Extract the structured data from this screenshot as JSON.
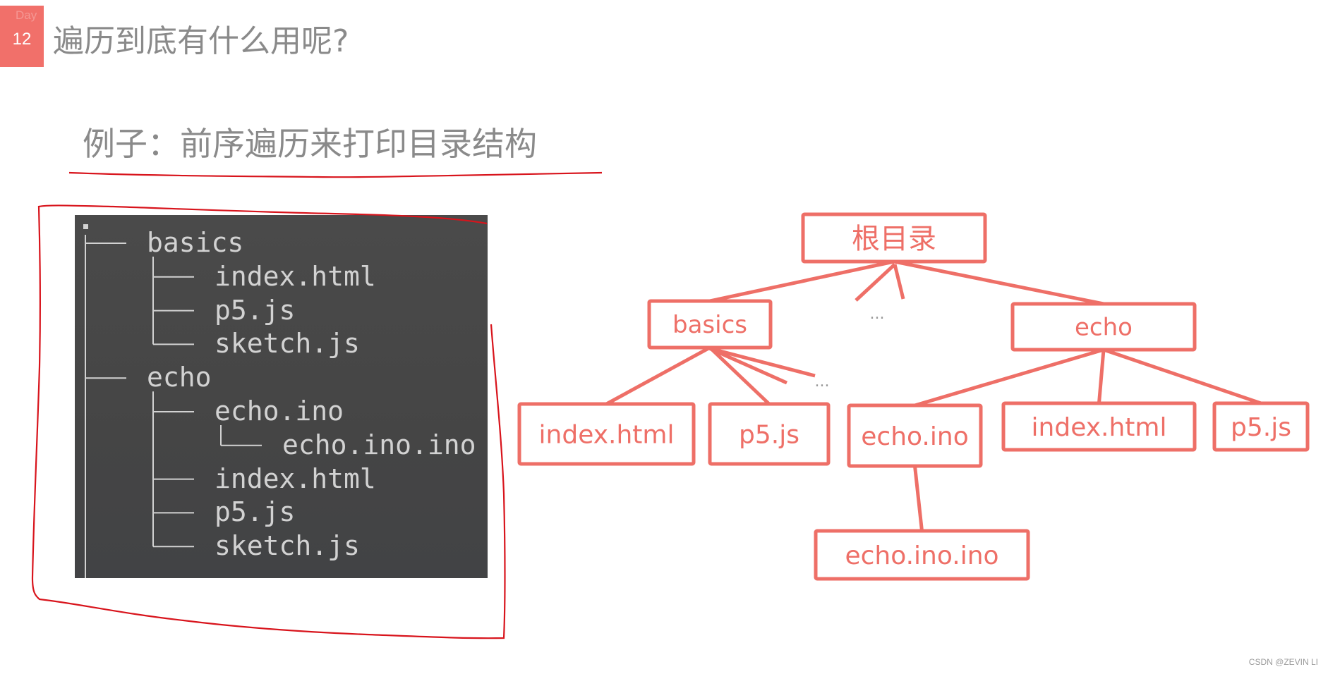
{
  "header": {
    "badge_top": "Day",
    "badge_number": "12",
    "title": "遍历到底有什么用呢?"
  },
  "subtitle": "例子：前序遍历来打印目录结构",
  "terminal": {
    "root": ".",
    "lines": [
      {
        "prefix": "├── ",
        "name": "basics",
        "depth": 0
      },
      {
        "prefix": "├── ",
        "name": "index.html",
        "depth": 1
      },
      {
        "prefix": "├── ",
        "name": "p5.js",
        "depth": 1
      },
      {
        "prefix": "└── ",
        "name": "sketch.js",
        "depth": 1
      },
      {
        "prefix": "├── ",
        "name": "echo",
        "depth": 0
      },
      {
        "prefix": "├── ",
        "name": "echo.ino",
        "depth": 1
      },
      {
        "prefix": "└── ",
        "name": "echo.ino.ino",
        "depth": 2
      },
      {
        "prefix": "├── ",
        "name": "index.html",
        "depth": 1
      },
      {
        "prefix": "├── ",
        "name": "p5.js",
        "depth": 1
      },
      {
        "prefix": "└── ",
        "name": "sketch.js",
        "depth": 1
      }
    ]
  },
  "tree": {
    "color": "#ee6f67",
    "nodes": [
      {
        "id": "root",
        "label": "根目录",
        "parent": null
      },
      {
        "id": "basics",
        "label": "basics",
        "parent": "root"
      },
      {
        "id": "echo",
        "label": "echo",
        "parent": "root"
      },
      {
        "id": "b-index",
        "label": "index.html",
        "parent": "basics"
      },
      {
        "id": "b-p5",
        "label": "p5.js",
        "parent": "basics"
      },
      {
        "id": "e-echoino",
        "label": "echo.ino",
        "parent": "echo"
      },
      {
        "id": "e-index",
        "label": "index.html",
        "parent": "echo"
      },
      {
        "id": "e-p5",
        "label": "p5.js",
        "parent": "echo"
      },
      {
        "id": "e-echoinoino",
        "label": "echo.ino.ino",
        "parent": "e-echoino"
      }
    ],
    "ellipses": [
      "...",
      "..."
    ]
  },
  "annotation_color": "#d8141c",
  "watermark": "CSDN @ZEVIN LI"
}
